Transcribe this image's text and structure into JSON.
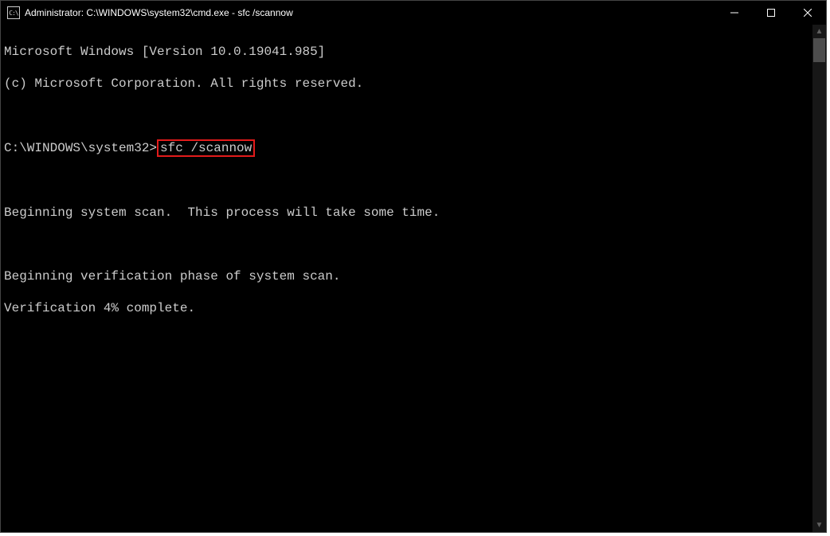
{
  "titlebar": {
    "icon_label": "C:\\",
    "title": "Administrator: C:\\WINDOWS\\system32\\cmd.exe - sfc  /scannow"
  },
  "terminal": {
    "line1": "Microsoft Windows [Version 10.0.19041.985]",
    "line2": "(c) Microsoft Corporation. All rights reserved.",
    "blank1": "",
    "prompt_prefix": "C:\\WINDOWS\\system32>",
    "highlighted_command": "sfc /scannow",
    "blank2": "",
    "line5": "Beginning system scan.  This process will take some time.",
    "blank3": "",
    "line7": "Beginning verification phase of system scan.",
    "line8": "Verification 4% complete."
  }
}
